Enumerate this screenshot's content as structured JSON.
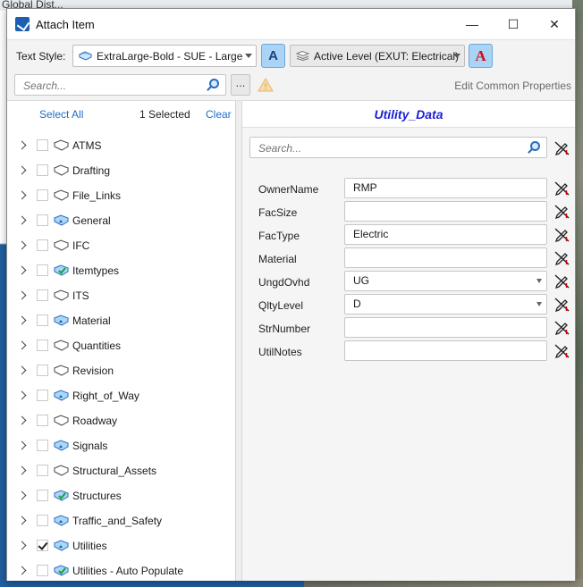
{
  "window": {
    "title": "Attach Item"
  },
  "background": {
    "top_text": "Global Dist..."
  },
  "toolbar": {
    "text_style_label": "Text Style:",
    "text_style_value": "ExtraLarge-Bold - SUE - Large",
    "level_value": "Active Level (EXUT: Electrical)"
  },
  "search": {
    "placeholder": "Search...",
    "more_label": "...",
    "edit_common": "Edit Common Properties"
  },
  "left_panel": {
    "select_all": "Select All",
    "selected_count": "1  Selected",
    "clear": "Clear",
    "items": [
      {
        "label": "ATMS",
        "checked": false,
        "icon": "folder-icon"
      },
      {
        "label": "Drafting",
        "checked": false,
        "icon": "folder-icon"
      },
      {
        "label": "File_Links",
        "checked": false,
        "icon": "folder-icon"
      },
      {
        "label": "General",
        "checked": false,
        "icon": "folder-special-icon"
      },
      {
        "label": "IFC",
        "checked": false,
        "icon": "folder-icon"
      },
      {
        "label": "Itemtypes",
        "checked": false,
        "icon": "folder-check-icon"
      },
      {
        "label": "ITS",
        "checked": false,
        "icon": "folder-icon"
      },
      {
        "label": "Material",
        "checked": false,
        "icon": "folder-special-icon"
      },
      {
        "label": "Quantities",
        "checked": false,
        "icon": "folder-icon"
      },
      {
        "label": "Revision",
        "checked": false,
        "icon": "folder-icon"
      },
      {
        "label": "Right_of_Way",
        "checked": false,
        "icon": "folder-special-icon"
      },
      {
        "label": "Roadway",
        "checked": false,
        "icon": "folder-icon"
      },
      {
        "label": "Signals",
        "checked": false,
        "icon": "folder-special-icon"
      },
      {
        "label": "Structural_Assets",
        "checked": false,
        "icon": "folder-icon"
      },
      {
        "label": "Structures",
        "checked": false,
        "icon": "folder-check-icon"
      },
      {
        "label": "Traffic_and_Safety",
        "checked": false,
        "icon": "folder-special-icon"
      },
      {
        "label": "Utilities",
        "checked": true,
        "icon": "folder-special-icon"
      },
      {
        "label": "Utilities - Auto Populate",
        "checked": false,
        "icon": "folder-check-icon"
      }
    ]
  },
  "right_panel": {
    "title": "Utility_Data",
    "search_placeholder": "Search...",
    "properties": [
      {
        "name": "OwnerName",
        "value": "RMP",
        "dropdown": false
      },
      {
        "name": "FacSize",
        "value": "",
        "dropdown": false
      },
      {
        "name": "FacType",
        "value": "Electric",
        "dropdown": false
      },
      {
        "name": "Material",
        "value": "",
        "dropdown": false
      },
      {
        "name": "UngdOvhd",
        "value": "UG",
        "dropdown": true
      },
      {
        "name": "QltyLevel",
        "value": "D",
        "dropdown": true
      },
      {
        "name": "StrNumber",
        "value": "",
        "dropdown": false
      },
      {
        "name": "UtilNotes",
        "value": "",
        "dropdown": false
      }
    ]
  },
  "colors": {
    "link": "#1f6fc5",
    "title": "#1a1fd6",
    "accent_button": "#a9d4f5"
  }
}
